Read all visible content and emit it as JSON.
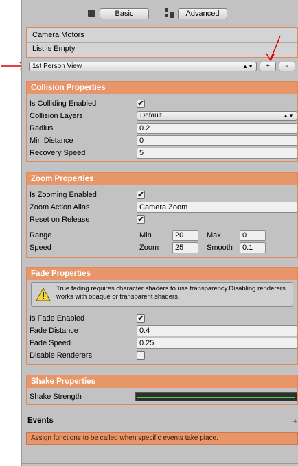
{
  "toolbar": {
    "basic_label": "Basic",
    "advanced_label": "Advanced"
  },
  "camera_motors": {
    "title": "Camera Motors",
    "empty_text": "List is Empty",
    "selected_motor": "1st Person View",
    "add_label": "+",
    "remove_label": "-"
  },
  "collision": {
    "header": "Collision Properties",
    "is_colliding_label": "Is Colliding Enabled",
    "is_colliding": true,
    "layers_label": "Collision Layers",
    "layers_value": "Default",
    "radius_label": "Radius",
    "radius_value": "0.2",
    "min_distance_label": "Min Distance",
    "min_distance_value": "0",
    "recovery_label": "Recovery Speed",
    "recovery_value": "5"
  },
  "zoom": {
    "header": "Zoom Properties",
    "is_zooming_label": "Is Zooming Enabled",
    "is_zooming": true,
    "alias_label": "Zoom Action Alias",
    "alias_value": "Camera Zoom",
    "reset_label": "Reset on Release",
    "reset": true,
    "range_label": "Range",
    "min_label": "Min",
    "min_value": "20",
    "max_label": "Max",
    "max_value": "0",
    "speed_label": "Speed",
    "zoom_label": "Zoom",
    "zoom_value": "25",
    "smooth_label": "Smooth",
    "smooth_value": "0.1"
  },
  "fade": {
    "header": "Fade Properties",
    "warning": "True fading requires character shaders to use transparency.Disabling renderers works with opaque or transparent shaders.",
    "is_fade_label": "Is Fade Enabled",
    "is_fade": true,
    "distance_label": "Fade Distance",
    "distance_value": "0.4",
    "speed_label": "Fade Speed",
    "speed_value": "0.25",
    "disable_renderers_label": "Disable Renderers",
    "disable_renderers": false
  },
  "shake": {
    "header": "Shake Properties",
    "strength_label": "Shake Strength"
  },
  "events": {
    "title": "Events",
    "add_label": "+",
    "help": "Assign functions to be called when specific events take place."
  },
  "annotations": {
    "arrow_color": "#e00000"
  }
}
